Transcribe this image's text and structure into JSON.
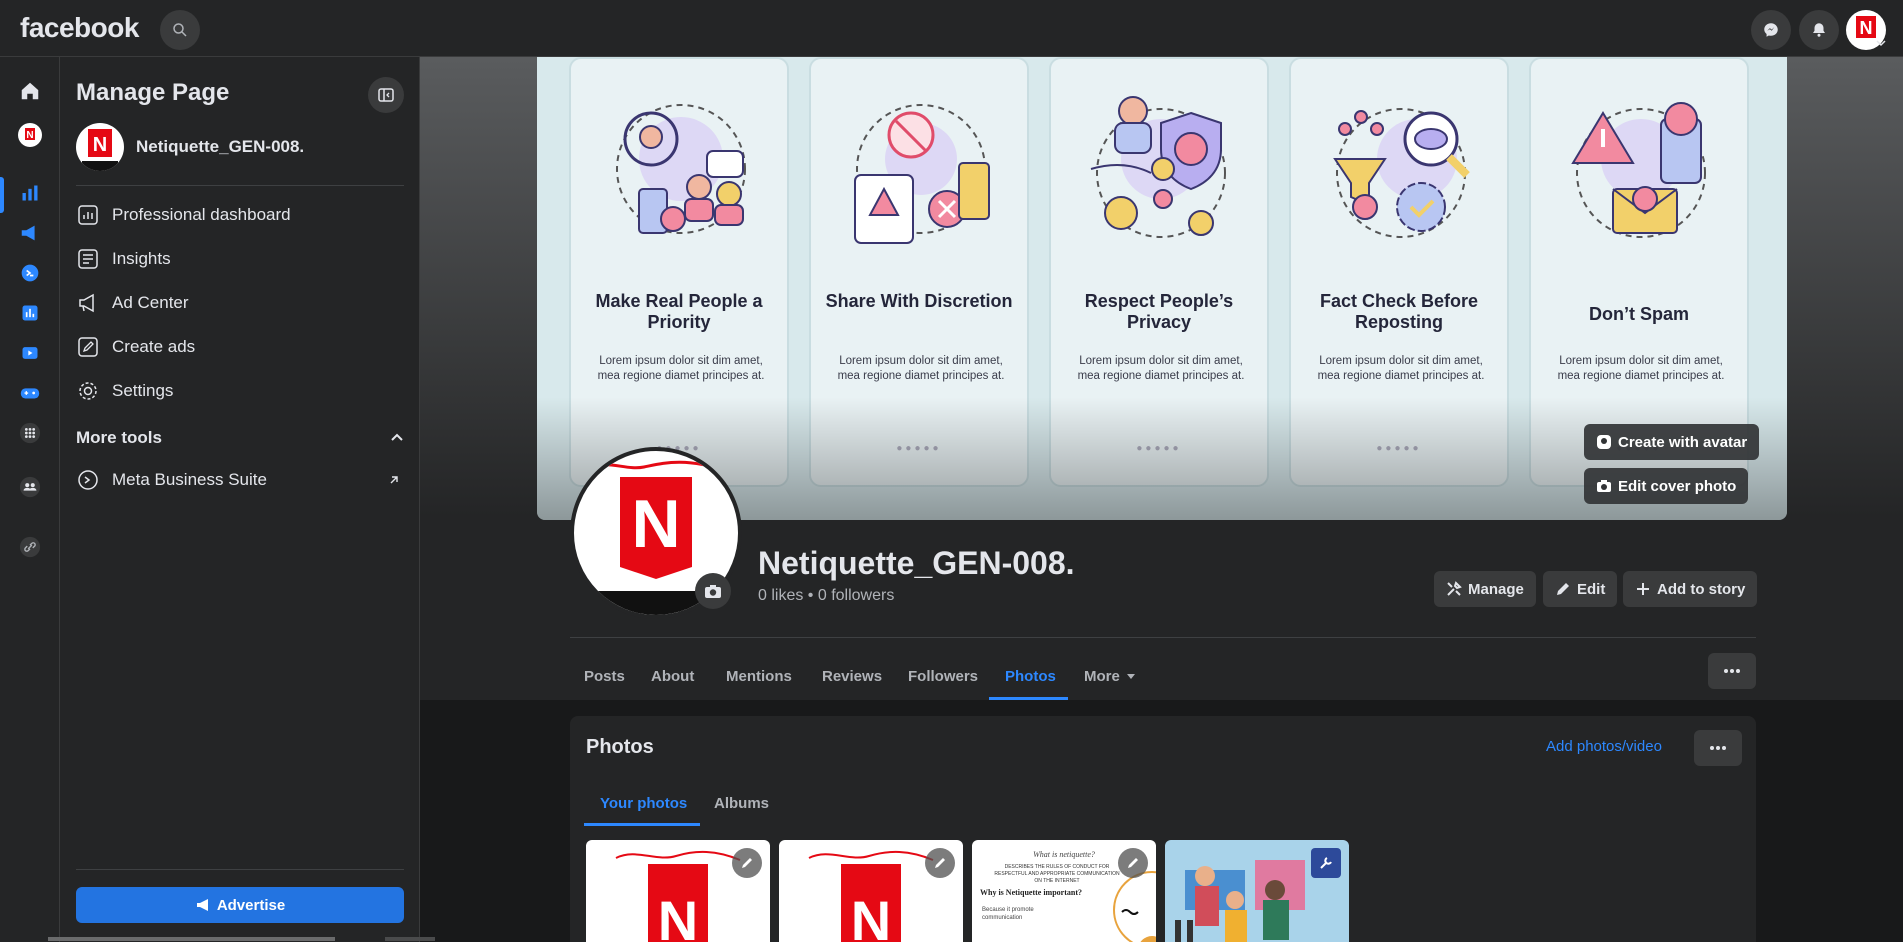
{
  "topbar": {
    "logo": "facebook",
    "search_icon": "search-icon",
    "messenger_icon": "messenger-icon",
    "notifications_icon": "bell-icon"
  },
  "rail": {
    "icons": [
      "home-icon",
      "page-avatar-icon",
      "insights-icon",
      "megaphone-icon",
      "business-icon",
      "chart-icon",
      "video-icon",
      "gaming-icon",
      "apps-grid-icon",
      "groups-icon",
      "link-icon"
    ]
  },
  "panel": {
    "title": "Manage Page",
    "page_name": "Netiquette_GEN-008.",
    "menu": [
      {
        "label": "Professional dashboard",
        "icon": "dashboard-icon"
      },
      {
        "label": "Insights",
        "icon": "insights-icon"
      },
      {
        "label": "Ad Center",
        "icon": "megaphone-icon"
      },
      {
        "label": "Create ads",
        "icon": "pencil-icon"
      },
      {
        "label": "Settings",
        "icon": "gear-icon"
      }
    ],
    "more_tools": "More tools",
    "meta_business_suite": "Meta Business Suite",
    "advertise": "Advertise"
  },
  "cover": {
    "cards": [
      {
        "title": "Make Real People a Priority",
        "body": "Lorem ipsum dolor sit dim amet, mea regione diamet principes at."
      },
      {
        "title": "Share With Discretion",
        "body": "Lorem ipsum dolor sit dim amet, mea regione diamet principes at."
      },
      {
        "title": "Respect People’s Privacy",
        "body": "Lorem ipsum dolor sit dim amet, mea regione diamet principes at."
      },
      {
        "title": "Fact Check Before Reposting",
        "body": "Lorem ipsum dolor sit dim amet, mea regione diamet principes at."
      },
      {
        "title": "Don’t Spam",
        "body": "Lorem ipsum dolor sit dim amet, mea regione diamet principes at."
      }
    ],
    "create_avatar": "Create with avatar",
    "edit_cover": "Edit cover photo"
  },
  "profile": {
    "name": "Netiquette_GEN-008.",
    "stats": "0 likes • 0 followers",
    "manage": "Manage",
    "edit": "Edit",
    "add_story": "Add to story"
  },
  "tabs": [
    "Posts",
    "About",
    "Mentions",
    "Reviews",
    "Followers",
    "Photos",
    "More"
  ],
  "photos": {
    "title": "Photos",
    "add": "Add photos/video",
    "tab_your": "Your photos",
    "tab_albums": "Albums",
    "thumb3_q1": "What is netiquette?",
    "thumb3_a1": "DESCRIBES THE RULES OF CONDUCT FOR RESPECTFUL AND APPROPRIATE COMMUNICATION ON THE INTERNET",
    "thumb3_q2": "Why is Netiquette important?",
    "thumb3_a2": "Because it promote communication"
  },
  "colors": {
    "accent": "#2d88ff",
    "button": "#2374e1",
    "netflix_red": "#e50914"
  }
}
